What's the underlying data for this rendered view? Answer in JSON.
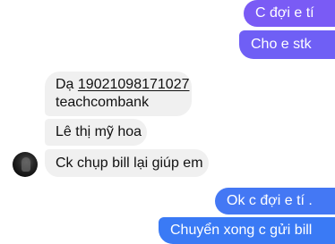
{
  "colors": {
    "outgoing_top": "#7b5cf6",
    "outgoing_bottom": "#3d7df5",
    "incoming_bg": "#f0f0f0"
  },
  "messages": [
    {
      "direction": "out",
      "text": "C đợi e tí"
    },
    {
      "direction": "out",
      "text": "Cho e stk"
    },
    {
      "direction": "in",
      "lines": [
        "Dạ 19021098171027",
        "teachcombank"
      ]
    },
    {
      "direction": "in",
      "text": "Lê thị mỹ hoa"
    },
    {
      "direction": "in",
      "text": "Ck chụp bill lại giúp em"
    },
    {
      "direction": "out",
      "text": "Ok c đợi e tí ."
    },
    {
      "direction": "out",
      "text": "Chuyển xong c gửi bill"
    }
  ],
  "account": {
    "prefix": "Dạ ",
    "number": "19021098171027"
  },
  "avatar": {
    "icon": "contact-avatar"
  }
}
